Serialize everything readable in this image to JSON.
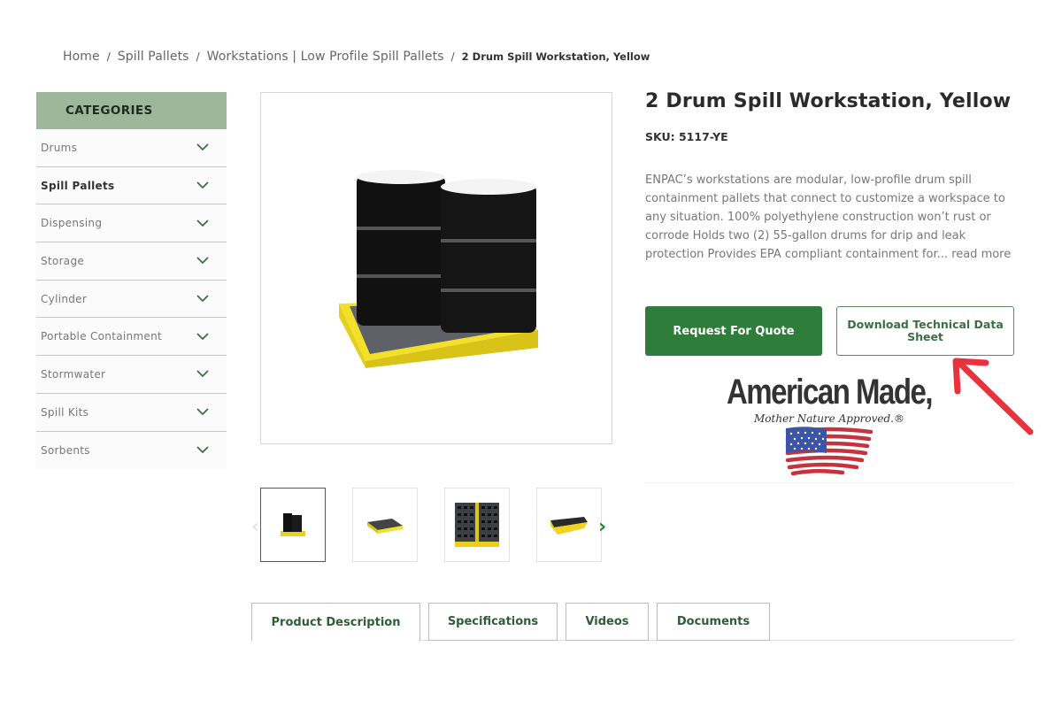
{
  "breadcrumb": {
    "items": [
      "Home",
      "Spill Pallets",
      "Workstations | Low Profile Spill Pallets"
    ],
    "separator": "/",
    "current": "2 Drum Spill Workstation, Yellow"
  },
  "sidebar": {
    "heading": "CATEGORIES",
    "items": [
      {
        "label": "Drums",
        "active": false
      },
      {
        "label": "Spill Pallets",
        "active": true
      },
      {
        "label": "Dispensing",
        "active": false
      },
      {
        "label": "Storage",
        "active": false
      },
      {
        "label": "Cylinder",
        "active": false
      },
      {
        "label": "Portable Containment",
        "active": false
      },
      {
        "label": "Stormwater",
        "active": false
      },
      {
        "label": "Spill Kits",
        "active": false
      },
      {
        "label": "Sorbents",
        "active": false
      }
    ]
  },
  "product": {
    "title": "2 Drum Spill Workstation, Yellow",
    "sku": "SKU: 5117-YE",
    "description": "ENPAC’s workstations are modular, low-profile drum spill containment pallets that connect to customize a workspace to any situation. 100% polyethylene construction won’t rust or corrode Holds two (2) 55-gallon drums for drip and leak protection Provides EPA compliant containment for...",
    "read_more": "read more",
    "quote_button": "Request For Quote",
    "download_button": "Download Technical Data Sheet"
  },
  "gallery": {
    "main_image": "2-drum-workstation-with-drums",
    "thumbnails": [
      "workstation-with-drums",
      "workstation-empty",
      "grating-closeup",
      "workstation-angled"
    ],
    "active_index": 0,
    "prev_icon": "‹",
    "next_icon": "›"
  },
  "badge": {
    "headline": "American Made,",
    "tagline": "Mother Nature Approved.®"
  },
  "tabs": [
    {
      "label": "Product Description",
      "active": true
    },
    {
      "label": "Specifications",
      "active": false
    },
    {
      "label": "Videos",
      "active": false
    },
    {
      "label": "Documents",
      "active": false
    }
  ],
  "colors": {
    "brand_green": "#2e7d3a",
    "sidebar_header": "#9db69c",
    "annotation_red": "#e8323c"
  }
}
